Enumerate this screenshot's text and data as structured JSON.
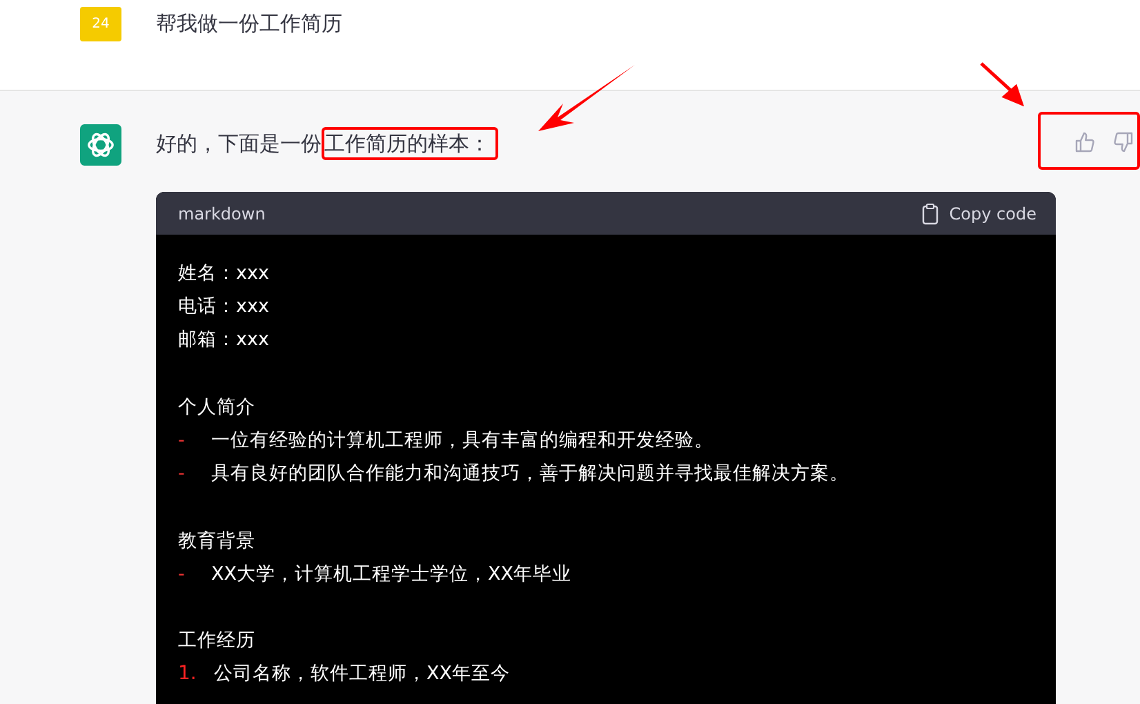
{
  "user_message": {
    "avatar": "24",
    "text": "帮我做一份工作简历"
  },
  "assistant_message": {
    "text": "好的，下面是一份",
    "highlighted_text": "工作简历的样本："
  },
  "code_block": {
    "language": "markdown",
    "copy_label": "Copy code",
    "lines": [
      {
        "kind": "text",
        "text": "姓名：xxx"
      },
      {
        "kind": "text",
        "text": "电话：xxx"
      },
      {
        "kind": "text",
        "text": "邮箱：xxx"
      },
      {
        "kind": "blank"
      },
      {
        "kind": "text",
        "text": "个人简介"
      },
      {
        "kind": "bullet",
        "marker": "-",
        "text": "一位有经验的计算机工程师，具有丰富的编程和开发经验。"
      },
      {
        "kind": "bullet",
        "marker": "-",
        "text": "具有良好的团队合作能力和沟通技巧，善于解决问题并寻找最佳解决方案。"
      },
      {
        "kind": "blank"
      },
      {
        "kind": "text",
        "text": "教育背景"
      },
      {
        "kind": "bullet",
        "marker": "-",
        "text": "XX大学，计算机工程学士学位，XX年毕业"
      },
      {
        "kind": "blank"
      },
      {
        "kind": "text",
        "text": "工作经历"
      },
      {
        "kind": "numbered",
        "marker": "1.",
        "text": "公司名称，软件工程师，XX年至今"
      }
    ]
  }
}
